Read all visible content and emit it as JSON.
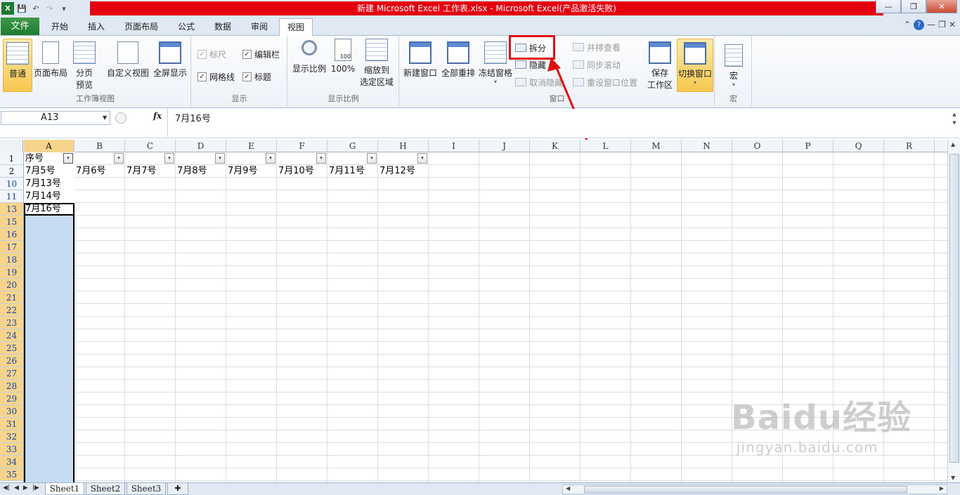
{
  "titlebar": {
    "title": "新建 Microsoft Excel 工作表.xlsx - Microsoft Excel(产品激活失败)"
  },
  "tabs": [
    {
      "label": "文件"
    },
    {
      "label": "开始"
    },
    {
      "label": "插入"
    },
    {
      "label": "页面布局"
    },
    {
      "label": "公式"
    },
    {
      "label": "数据"
    },
    {
      "label": "审阅"
    },
    {
      "label": "视图"
    }
  ],
  "active_tab": "视图",
  "ribbon": {
    "workbook_views": {
      "label": "工作簿视图",
      "normal": "普通",
      "page_layout": "页面布局",
      "page_break_1": "分页",
      "page_break_2": "预览",
      "custom_views": "自定义视图",
      "full_screen": "全屏显示"
    },
    "show": {
      "label": "显示",
      "ruler": "标尺",
      "formula_bar": "编辑栏",
      "gridlines": "网格线",
      "headings": "标题"
    },
    "zoom": {
      "label": "显示比例",
      "zoom": "显示比例",
      "hundred": "100%",
      "zoom_sel_1": "缩放到",
      "zoom_sel_2": "选定区域",
      "hundred_icon_text": "100"
    },
    "window": {
      "label": "窗口",
      "new_window": "新建窗口",
      "arrange_all": "全部重排",
      "freeze": "冻结窗格",
      "split": "拆分",
      "hide": "隐藏",
      "unhide": "取消隐藏",
      "side_by_side": "并排查看",
      "sync_scroll": "同步滚动",
      "reset_pos": "重设窗口位置",
      "save_ws_1": "保存",
      "save_ws_2": "工作区",
      "switch": "切换窗口"
    },
    "macros": {
      "label": "宏",
      "macros": "宏"
    }
  },
  "formula": {
    "namebox": "A13",
    "fx": "fx",
    "content": "7月16号"
  },
  "columns": [
    "A",
    "B",
    "C",
    "D",
    "E",
    "F",
    "G",
    "H",
    "I",
    "J",
    "K",
    "L",
    "M",
    "N",
    "O",
    "P",
    "Q",
    "R"
  ],
  "rows": [
    "1",
    "2",
    "10",
    "11",
    "13",
    "15",
    "16",
    "17",
    "18",
    "19",
    "20",
    "21",
    "22",
    "23",
    "24",
    "25",
    "26",
    "27",
    "28",
    "29",
    "30",
    "31",
    "32",
    "33",
    "34",
    "35"
  ],
  "cells": {
    "A1": "序号",
    "A2": "7月5号",
    "B2": "7月6号",
    "C2": "7月7号",
    "D2": "7月8号",
    "E2": "7月9号",
    "F2": "7月10号",
    "G2": "7月11号",
    "H2": "7月12号",
    "A10": "7月13号",
    "A11": "7月14号",
    "A13": "7月16号"
  },
  "sheets": [
    "Sheet1",
    "Sheet2",
    "Sheet3"
  ],
  "watermark": {
    "big": "Baidu经验",
    "small": "jingyan.baidu.com"
  }
}
